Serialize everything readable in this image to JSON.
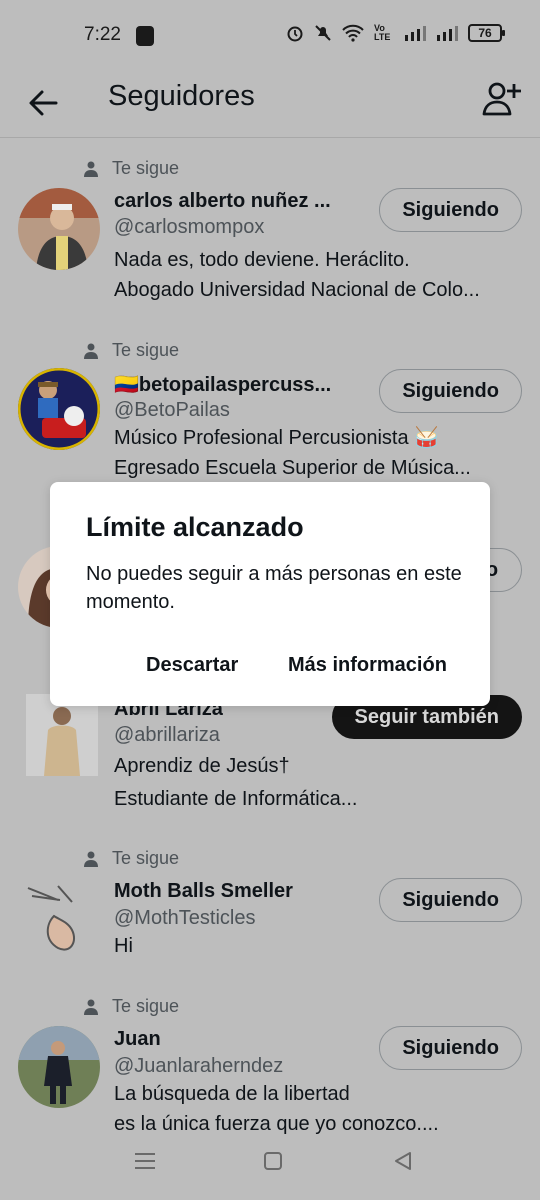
{
  "status": {
    "time": "7:22",
    "battery": "76",
    "network_label": "Vo LTE"
  },
  "header": {
    "title": "Seguidores",
    "back_icon": "arrow-left-icon",
    "add_icon": "add-user-icon"
  },
  "followers": [
    {
      "follows_you": "Te sigue",
      "name": "carlos alberto nuñez ...",
      "handle": "@carlosmompox",
      "bio": [
        "Nada es, todo deviene. Heráclito.",
        "Abogado Universidad Nacional de Colo..."
      ],
      "button": "Siguiendo"
    },
    {
      "follows_you": "Te sigue",
      "name": "🇨🇴betopailaspercuss...",
      "handle": "@BetoPailas",
      "bio": [
        "Músico Profesional Percusionista 🥁",
        "Egresado Escuela Superior de Música..."
      ],
      "button": "Siguiendo"
    },
    {
      "follows_you": "",
      "name": "Abril Lariza",
      "handle": "@abrillariza",
      "bio": [
        "Aprendiz de Jesús†",
        "Estudiante de Informática..."
      ],
      "button": "Seguir también"
    },
    {
      "follows_you": "Te sigue",
      "name": "Moth Balls Smeller",
      "handle": "@MothTesticles",
      "bio": [
        "Hi"
      ],
      "button": "Siguiendo"
    },
    {
      "follows_you": "Te sigue",
      "name": "Juan",
      "handle": "@Juanlaraherndez",
      "bio": [
        "La búsqueda de la libertad",
        "es la única fuerza que yo conozco...."
      ],
      "button": "Siguiendo"
    }
  ],
  "hidden_row_button": "o",
  "dialog": {
    "title": "Límite alcanzado",
    "message": "No puedes seguir a más personas en este momento.",
    "dismiss": "Descartar",
    "more_info": "Más información"
  },
  "colors": {
    "overlay": "#bdbdbd",
    "dialog": "#ffffff",
    "text": "#0f1419",
    "muted": "#4d5358"
  }
}
